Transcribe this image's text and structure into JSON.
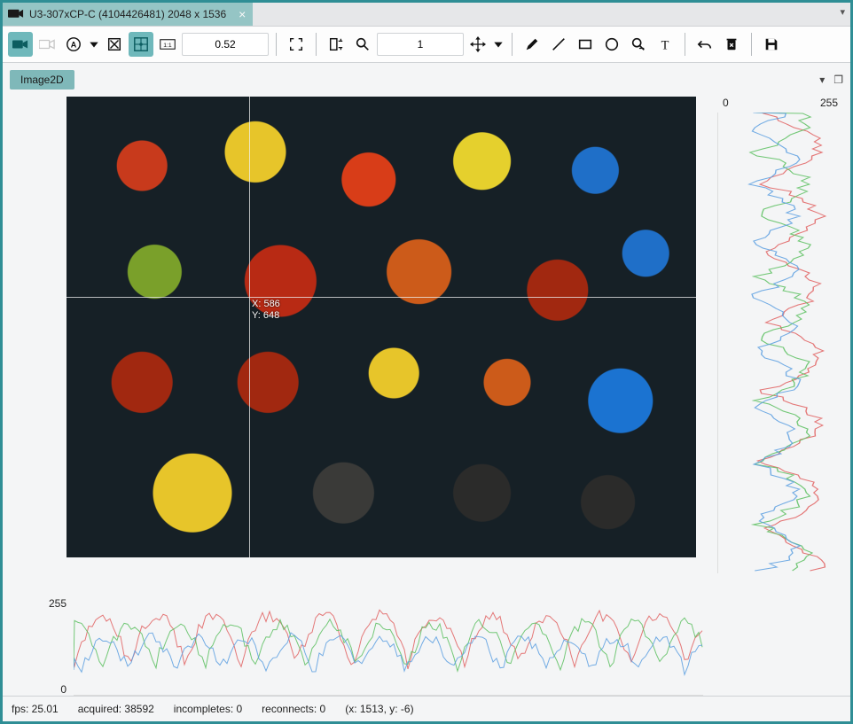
{
  "title_tab": {
    "icon": "camera-icon",
    "text": "U3-307xCP-C (4104426481) 2048 x 1536"
  },
  "toolbar": {
    "zoom_value": "0.52",
    "step_value": "1"
  },
  "subtab": {
    "label": "Image2D"
  },
  "crosshair": {
    "x_label": "X: 586",
    "y_label": "Y: 648"
  },
  "profile": {
    "min": "0",
    "max": "255"
  },
  "status": {
    "fps": "fps: 25.01",
    "acquired": "acquired: 38592",
    "incompletes": "incompletes: 0",
    "reconnects": "reconnects: 0",
    "cursor": "(x: 1513, y: -6)"
  },
  "colors": {
    "r": "#e06060",
    "g": "#5cbf60",
    "b": "#5c9fe0"
  }
}
